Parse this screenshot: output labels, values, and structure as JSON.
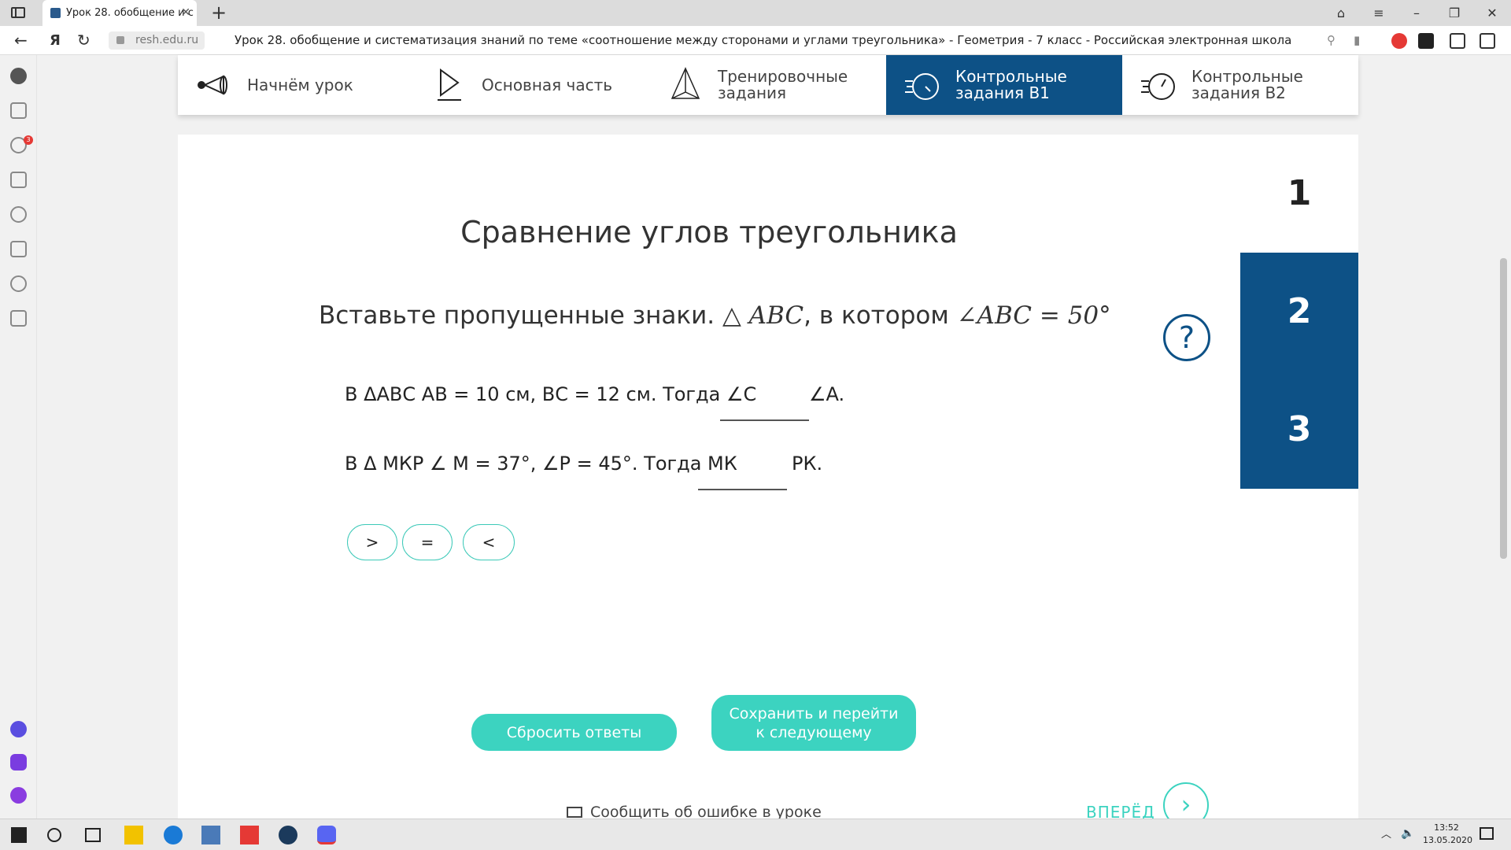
{
  "browser": {
    "tab_title": "Урок 28. обобщение и с",
    "url_domain": "resh.edu.ru",
    "page_title": "Урок 28. обобщение и систематизация знаний по теме «соотношение между сторонами и углами треугольника» - Геометрия - 7 класс - Российская электронная школа"
  },
  "sidebar": {
    "notification_count": "3"
  },
  "lesson_nav": [
    {
      "label": "Начнём урок",
      "icon": "megaphone-icon",
      "active": false
    },
    {
      "label": "Основная часть",
      "icon": "play-icon",
      "active": false
    },
    {
      "label": "Тренировочные задания",
      "icon": "pyramid-icon",
      "active": false
    },
    {
      "label": "Контрольные задания В1",
      "icon": "stopwatch-icon",
      "active": true
    },
    {
      "label": "Контрольные задания В2",
      "icon": "stopwatch-icon",
      "active": false
    }
  ],
  "task": {
    "title": "Сравнение углов треугольника",
    "question_text": "Вставьте пропущенные знаки.",
    "question_triangle": "△ ABC",
    "question_mid": ", в котором",
    "question_angle": "∠ABC = 50°",
    "line1_text": "В ΔАВС АВ = 10 см, ВС = 12 см. Тогда ∠C",
    "line1_tail": "∠A.",
    "line2_text": "В Δ МКР ∠ М = 37°, ∠Р = 45°. Тогда МК",
    "line2_tail": "РК.",
    "options": [
      ">",
      "=",
      "<"
    ],
    "reset_label": "Сбросить ответы",
    "save_label": "Сохранить и перейти к следующему",
    "report_label": "Сообщить об ошибке в уроке",
    "next_label": "ВПЕРЁД"
  },
  "task_numbers": [
    "1",
    "2",
    "3"
  ],
  "taskbar": {
    "time": "13:52",
    "date": "13.05.2020"
  }
}
